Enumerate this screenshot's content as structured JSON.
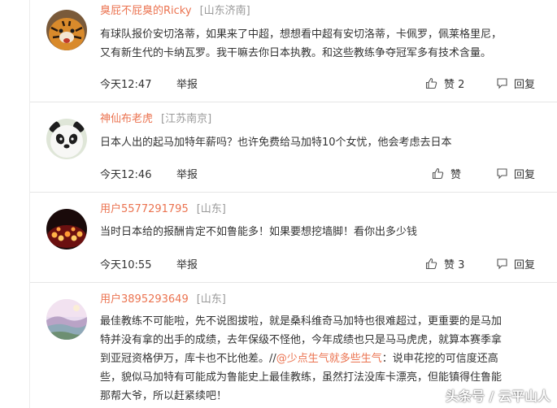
{
  "comments": [
    {
      "avatar_icon": "tiger-avatar-icon",
      "username": "臭屁不屁臭的Ricky",
      "location": "[山东济南]",
      "text_lines": [
        "有球队报价安切洛蒂，如果来了中超，想想看中超有安切洛蒂，卡佩罗，佩莱格里尼，",
        "又有新生代的卡纳瓦罗。我干嘛去你日本执教。和这些教练争夺冠军多有技术含量。"
      ],
      "time": "今天12:47",
      "report_label": "举报",
      "like_label": "赞",
      "like_count": "2",
      "reply_label": "回复"
    },
    {
      "avatar_icon": "panda-avatar-icon",
      "username": "神仙布老虎",
      "location": "[江苏南京]",
      "text_lines": [
        "日本人出的起马加特年薪吗？也许免费给马加特10个女忧，他会考虑去日本"
      ],
      "time": "今天12:46",
      "report_label": "举报",
      "like_label": "赞",
      "like_count": "",
      "reply_label": "回复"
    },
    {
      "avatar_icon": "candles-avatar-icon",
      "username": "用户5577291795",
      "location": "[山东]",
      "text_lines": [
        "当时日本给的报酬肯定不如鲁能多！如果要想挖墙脚！看你出多少钱"
      ],
      "time": "今天10:55",
      "report_label": "举报",
      "like_label": "赞",
      "like_count": "3",
      "reply_label": "回复"
    },
    {
      "avatar_icon": "landscape-avatar-icon",
      "username": "用户3895293649",
      "location": "[山东]",
      "text_lines": [
        "最佳教练不可能啦，先不说图拔啦，就是桑科维奇马加特也很难超过，更重要的是马加",
        "特并没有拿的出手的成绩，去年保级不怪他，今年成绩也只是马马虎虎，就算本赛季拿",
        "到亚冠资格伊万，库卡也不比他差。//",
        "些，貌似马加特有可能成为鲁能史上最佳教练，虽然打法没库卡漂亮，但能镇得住鲁能",
        "那帮大爷，所以赶紧续吧！"
      ],
      "mention": "@少点生气就多些生气",
      "mention_after": "：说申花挖的可信度还高"
    }
  ],
  "watermark": "头条号 / 云平山人",
  "colors": {
    "username": "#eb7350",
    "location": "#999999",
    "text": "#333333",
    "divider": "#e6e6e6"
  }
}
